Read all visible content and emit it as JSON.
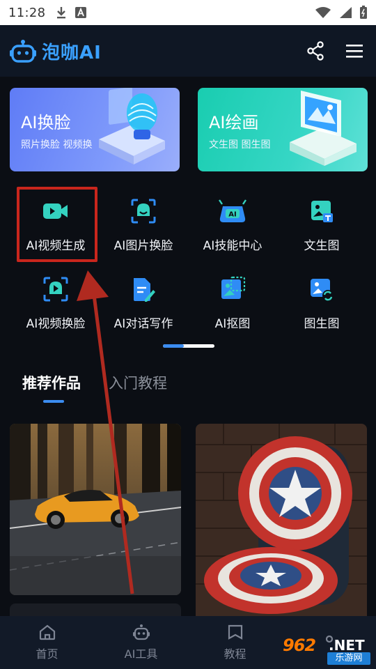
{
  "status_bar": {
    "time": "11:28"
  },
  "header": {
    "app_name": "泡咖AI"
  },
  "banners": [
    {
      "title": "AI换脸",
      "subtitle": "照片换脸 视频换"
    },
    {
      "title": "AI绘画",
      "subtitle": "文生图 图生图"
    }
  ],
  "tools": [
    {
      "label": "AI视频生成",
      "icon": "video-camera-icon"
    },
    {
      "label": "AI图片换脸",
      "icon": "face-scan-icon"
    },
    {
      "label": "AI技能中心",
      "icon": "ai-hub-icon"
    },
    {
      "label": "文生图",
      "icon": "text-to-image-icon"
    },
    {
      "label": "AI视频换脸",
      "icon": "video-face-icon"
    },
    {
      "label": "AI对话写作",
      "icon": "document-pen-icon"
    },
    {
      "label": "AI抠图",
      "icon": "cutout-icon"
    },
    {
      "label": "图生图",
      "icon": "image-to-image-icon"
    }
  ],
  "tabs": [
    {
      "label": "推荐作品",
      "active": true
    },
    {
      "label": "入门教程",
      "active": false
    }
  ],
  "bottom_nav": [
    {
      "label": "首页",
      "icon": "home-icon"
    },
    {
      "label": "AI工具",
      "icon": "robot-icon"
    },
    {
      "label": "教程",
      "icon": "book-icon"
    }
  ],
  "watermark": {
    "number": "962",
    "suffix": ".NET",
    "site": "乐游网"
  },
  "colors": {
    "accent": "#3b8cf0",
    "background": "#0b0e14",
    "highlight": "#c9261d",
    "tool_icon": "#34d2c0"
  }
}
